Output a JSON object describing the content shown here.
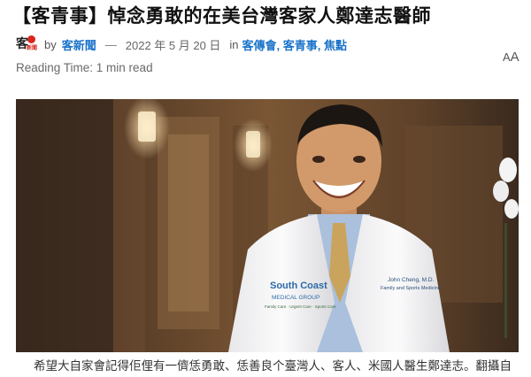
{
  "article": {
    "title": "【客青事】悼念勇敢的在美台灣客家人鄭達志醫師",
    "by_label": "by",
    "author": "客新聞",
    "separator": "—",
    "date": "2022 年 5 月 20 日",
    "in_label": "in",
    "categories": "客傳會, 客青事, 焦點",
    "reading_time": "Reading Time: 1 min read",
    "font_toggle_small": "A",
    "font_toggle_large": "A",
    "caption": "希望大自家會記得佢俚有一儕恁勇敢、恁善良个臺灣人、客人、米國人醫生鄭達志。翻攝自"
  },
  "logo": {
    "mark": "客",
    "sub": "新聞"
  },
  "photo": {
    "coat_logo_line1": "South Coast",
    "coat_logo_line2": "MEDICAL GROUP",
    "coat_logo_line3": "Family Care · Urgent Care · Sports Care",
    "name_tag_line1": "John Cheng, M.D.",
    "name_tag_line2": "Family and Sports Medicine"
  },
  "colors": {
    "link": "#1a73c9",
    "logo_red": "#d8261c"
  }
}
